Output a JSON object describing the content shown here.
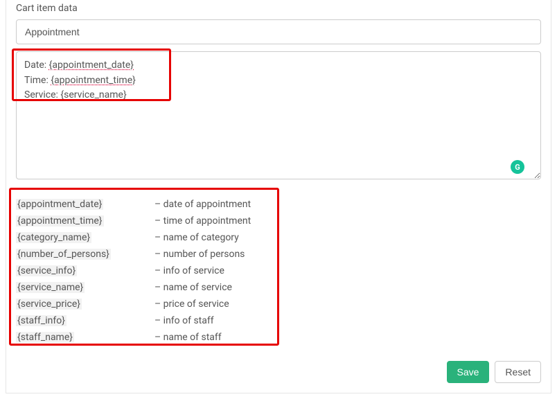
{
  "section_label": "Cart item data",
  "title_input": {
    "value": "Appointment"
  },
  "body_lines": [
    {
      "prefix": "Date: ",
      "placeholder": "{appointment_date}"
    },
    {
      "prefix": "Time: ",
      "placeholder": "{appointment_time}"
    },
    {
      "prefix": "Service: ",
      "placeholder": "{service_name}"
    }
  ],
  "placeholders": [
    {
      "key": "{appointment_date}",
      "desc": "– date of appointment"
    },
    {
      "key": "{appointment_time}",
      "desc": "– time of appointment"
    },
    {
      "key": "{category_name}",
      "desc": "– name of category"
    },
    {
      "key": "{number_of_persons}",
      "desc": "– number of persons"
    },
    {
      "key": "{service_info}",
      "desc": "– info of service"
    },
    {
      "key": "{service_name}",
      "desc": "– name of service"
    },
    {
      "key": "{service_price}",
      "desc": "– price of service"
    },
    {
      "key": "{staff_info}",
      "desc": "– info of staff"
    },
    {
      "key": "{staff_name}",
      "desc": "– name of staff"
    }
  ],
  "buttons": {
    "save": "Save",
    "reset": "Reset"
  },
  "grammarly_glyph": "G"
}
